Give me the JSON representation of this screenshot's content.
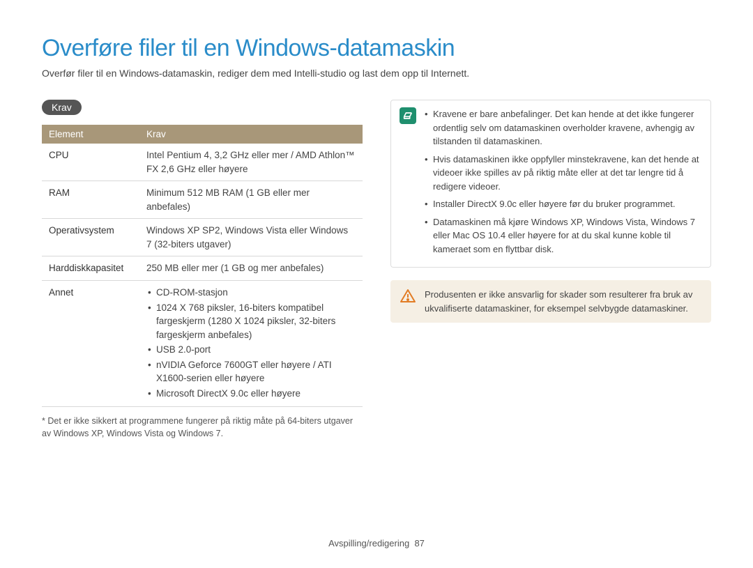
{
  "title": "Overføre filer til en Windows-datamaskin",
  "subtitle": "Overfør filer til en Windows-datamaskin, rediger dem med Intelli-studio og last dem opp til Internett.",
  "section_label": "Krav",
  "table": {
    "headers": {
      "col1": "Element",
      "col2": "Krav"
    },
    "rows": [
      {
        "element": "CPU",
        "req": "Intel Pentium 4, 3,2 GHz eller mer / AMD Athlon™ FX 2,6 GHz eller høyere"
      },
      {
        "element": "RAM",
        "req": "Minimum 512 MB RAM (1 GB eller mer anbefales)"
      },
      {
        "element": "Operativsystem",
        "req": "Windows XP SP2, Windows Vista eller Windows 7 (32-biters utgaver)"
      },
      {
        "element": "Harddiskkapasitet",
        "req": "250 MB eller mer (1 GB og mer anbefales)"
      }
    ],
    "annet_label": "Annet",
    "annet": [
      "CD-ROM-stasjon",
      "1024 X 768 piksler, 16-biters kompatibel fargeskjerm (1280 X 1024 piksler, 32-biters fargeskjerm anbefales)",
      "USB 2.0-port",
      "nVIDIA Geforce 7600GT eller høyere / ATI X1600-serien eller høyere",
      "Microsoft DirectX 9.0c eller høyere"
    ]
  },
  "footnote": "* Det er ikke sikkert at programmene fungerer på riktig måte på 64-biters utgaver av Windows XP, Windows Vista og Windows 7.",
  "info_notes": [
    "Kravene er bare anbefalinger. Det kan hende at det ikke fungerer ordentlig selv om datamaskinen overholder kravene, avhengig av tilstanden til datamaskinen.",
    "Hvis datamaskinen ikke oppfyller minstekravene, kan det hende at videoer ikke spilles av på riktig måte eller at det tar lengre tid å redigere videoer.",
    "Installer DirectX 9.0c eller høyere før du bruker programmet.",
    "Datamaskinen må kjøre Windows XP, Windows Vista, Windows 7 eller Mac OS 10.4 eller høyere for at du skal kunne koble til kameraet som en flyttbar disk."
  ],
  "warn_note": "Produsenten er ikke ansvarlig for skader som resulterer fra bruk av ukvalifiserte datamaskiner, for eksempel selvbygde datamaskiner.",
  "footer": {
    "section": "Avspilling/redigering",
    "page": "87"
  }
}
